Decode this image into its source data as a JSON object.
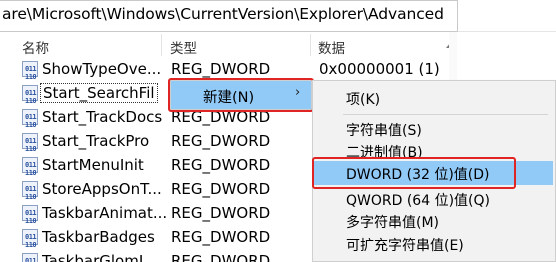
{
  "address": {
    "path": "are\\Microsoft\\Windows\\CurrentVersion\\Explorer\\Advanced"
  },
  "columns": {
    "name": "名称",
    "type": "类型",
    "data": "数据"
  },
  "rows": [
    {
      "name": "ShowTypeOve...",
      "type": "REG_DWORD",
      "data": "0x00000001 (1)"
    },
    {
      "name": "Start_SearchFil",
      "type": "",
      "data": ""
    },
    {
      "name": "Start_TrackDocs",
      "type": "REG_DWORD",
      "data": ""
    },
    {
      "name": "Start_TrackPro",
      "type": "REG_DWORD",
      "data": ""
    },
    {
      "name": "StartMenuInit",
      "type": "REG_DWORD",
      "data": ""
    },
    {
      "name": "StoreAppsOnT...",
      "type": "REG_DWORD",
      "data": ""
    },
    {
      "name": "TaskbarAnimat...",
      "type": "REG_DWORD",
      "data": ""
    },
    {
      "name": "TaskbarBadges",
      "type": "REG_DWORD",
      "data": ""
    },
    {
      "name": "TaskbarGlomL",
      "type": "REG_DWORD",
      "data": ""
    }
  ],
  "icons": {
    "reg_value": "binary-value-icon"
  },
  "context_menu": {
    "new_label": "新建(N)",
    "arrow": "›"
  },
  "submenu": {
    "items": [
      {
        "label": "项(K)"
      },
      {
        "label": "字符串值(S)"
      },
      {
        "label": "二进制值(B)"
      },
      {
        "label": "DWORD (32 位)值(D)"
      },
      {
        "label": "QWORD (64 位)值(Q)"
      },
      {
        "label": "多字符串值(M)"
      },
      {
        "label": "可扩充字符串值(E)"
      }
    ]
  },
  "colors": {
    "highlight": "#91c9f7",
    "annotation": "#e02424",
    "menu_bg": "#f2f2f2"
  }
}
